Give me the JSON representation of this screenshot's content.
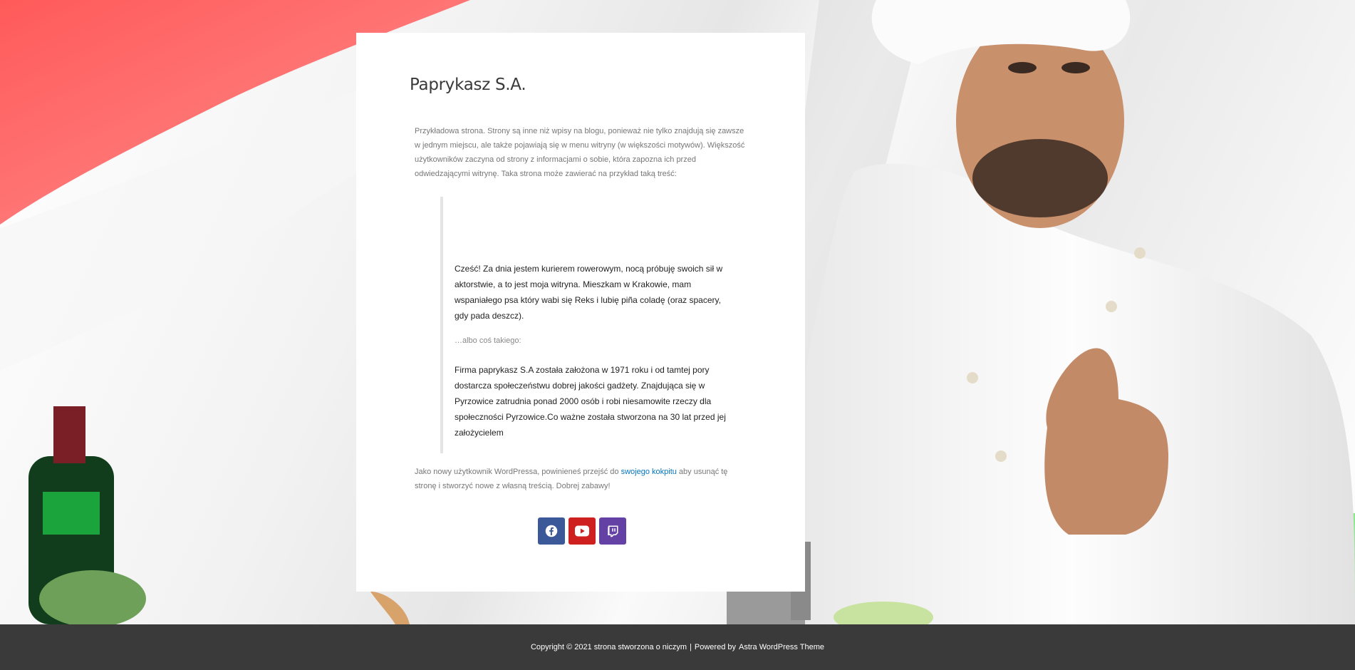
{
  "site": {
    "title": "Paprykasz S.A."
  },
  "content": {
    "intro": "Przykładowa strona. Strony są inne niż wpisy na blogu, ponieważ nie tylko znajdują się zawsze w jednym miejscu, ale także pojawiają się w menu witryny (w większości motywów). Większość użytkowników zaczyna od strony z informacjami o sobie, która zapozna ich przed odwiedzającymi witrynę. Taka strona może zawierać na przykład taką treść:",
    "quote": {
      "p1": "Cześć! Za dnia jestem kurierem rowerowym, nocą próbuję swoich sił w aktorstwie, a to jest moja witryna. Mieszkam w Krakowie, mam wspaniałego psa który wabi się Reks i lubię piña coladę (oraz spacery, gdy pada deszcz).",
      "p2": "…albo coś takiego:",
      "p3": "Firma paprykasz S.A została założona w 1971 roku i od tamtej pory dostarcza społeczeństwu dobrej jakości gadżety. Znajdująca się w Pyrzowice zatrudnia ponad 2000 osób i robi niesamowite rzeczy dla społeczności Pyrzowice.Co ważne została stworzona na 30 lat przed jej założycielem"
    },
    "outro_before": "Jako nowy użytkownik WordPressa, powinieneś przejść do ",
    "outro_link": "swojego kokpitu",
    "outro_after": " aby usunąć tę stronę i stworzyć nowe z własną treścią. Dobrej zabawy!"
  },
  "social": [
    {
      "icon": "facebook-icon",
      "color": "#3b5998"
    },
    {
      "icon": "youtube-icon",
      "color": "#cd201f"
    },
    {
      "icon": "twitch-icon",
      "color": "#6441a5"
    }
  ],
  "footer": {
    "copyright": "Copyright © 2021 strona stworzona o niczym",
    "separator": "|",
    "powered": "Powered by",
    "theme": "Astra WordPress Theme"
  },
  "colors": {
    "footer_bg": "#3a3a3a",
    "link": "#0274be",
    "flag_red": "#ff6b6b",
    "flag_green": "#7ee37e"
  }
}
